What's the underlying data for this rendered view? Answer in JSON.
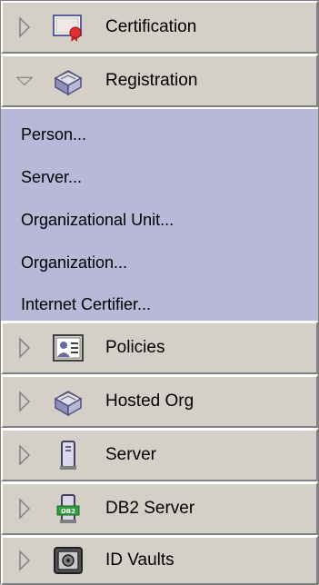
{
  "sections": [
    {
      "label": "Certification",
      "icon": "certificate-icon",
      "expanded": false
    },
    {
      "label": "Registration",
      "icon": "registration-box-icon",
      "expanded": true
    },
    {
      "label": "Policies",
      "icon": "policies-icon",
      "expanded": false
    },
    {
      "label": "Hosted Org",
      "icon": "hosted-org-icon",
      "expanded": false
    },
    {
      "label": "Server",
      "icon": "server-icon",
      "expanded": false
    },
    {
      "label": "DB2 Server",
      "icon": "db2-server-icon",
      "expanded": false
    },
    {
      "label": "ID Vaults",
      "icon": "id-vault-icon",
      "expanded": false
    }
  ],
  "registration_items": [
    "Person...",
    "Server...",
    "Organizational Unit...",
    "Organization...",
    "Internet Certifier..."
  ],
  "db2_badge": "DB2",
  "colors": {
    "panel": "#d4d0c8",
    "list_bg": "#b8b8d8"
  }
}
